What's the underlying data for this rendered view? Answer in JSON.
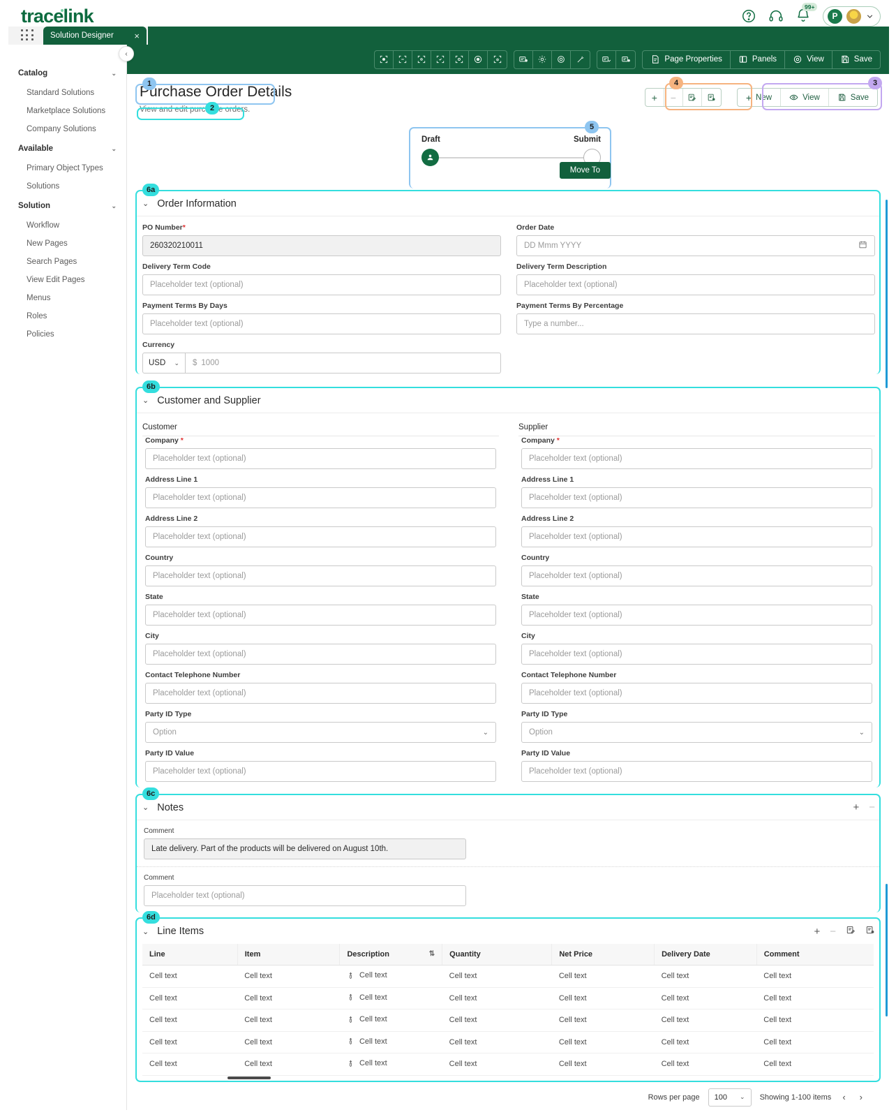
{
  "brand": {
    "name": "tracelink",
    "notification_badge": "99+",
    "account_initial": "P"
  },
  "tabs": {
    "active": "Solution Designer",
    "close": "×"
  },
  "sidebar": {
    "groups": [
      {
        "label": "Catalog",
        "items": [
          "Standard Solutions",
          "Marketplace Solutions",
          "Company Solutions"
        ]
      },
      {
        "label": "Available",
        "items": [
          "Primary Object Types",
          "Solutions"
        ]
      },
      {
        "label": "Solution",
        "items": [
          "Workflow",
          "New Pages",
          "Search Pages",
          "View Edit Pages",
          "Menus",
          "Roles",
          "Policies"
        ]
      }
    ]
  },
  "designer_toolbar": {
    "buttons": [
      {
        "label": "Page Properties",
        "icon": "page-properties-icon"
      },
      {
        "label": "Panels",
        "icon": "panels-icon"
      },
      {
        "label": "View",
        "icon": "eye-icon"
      },
      {
        "label": "Save",
        "icon": "save-icon"
      }
    ]
  },
  "page": {
    "title": "Purchase Order Details",
    "subtitle": "View and edit purchase orders."
  },
  "annotations": [
    {
      "id": "1",
      "color": "#8ec5f0",
      "target": "page-title"
    },
    {
      "id": "2",
      "color": "#34dede",
      "target": "page-subtitle"
    },
    {
      "id": "3",
      "color": "#c3a8f0",
      "target": "record-actions"
    },
    {
      "id": "4",
      "color": "#f6b37f",
      "target": "panel-actions"
    },
    {
      "id": "5",
      "color": "#8ec5f0",
      "target": "workflow"
    },
    {
      "id": "6a",
      "color": "#34dede",
      "target": "order-information"
    },
    {
      "id": "6b",
      "color": "#34dede",
      "target": "customer-and-supplier"
    },
    {
      "id": "6c",
      "color": "#34dede",
      "target": "notes"
    },
    {
      "id": "6d",
      "color": "#34dede",
      "target": "line-items"
    }
  ],
  "record_actions": {
    "new": "New",
    "view": "View",
    "save": "Save"
  },
  "panel_actions": {
    "add": "+",
    "remove": "−"
  },
  "workflow": {
    "steps": [
      "Draft",
      "Submit"
    ],
    "current_step": "Draft",
    "move_to": "Move To"
  },
  "order_information": {
    "title": "Order Information",
    "fields": [
      {
        "label": "PO Number",
        "required": true,
        "value": "260320210011",
        "placeholder": "",
        "type": "text-filled"
      },
      {
        "label": "Order Date",
        "required": false,
        "value": "",
        "placeholder": "DD Mmm YYYY",
        "type": "date"
      },
      {
        "label": "Delivery Term Code",
        "required": false,
        "value": "",
        "placeholder": "Placeholder text (optional)",
        "type": "text"
      },
      {
        "label": "Delivery Term Description",
        "required": false,
        "value": "",
        "placeholder": "Placeholder text (optional)",
        "type": "text"
      },
      {
        "label": "Payment Terms By Days",
        "required": false,
        "value": "",
        "placeholder": "Placeholder text (optional)",
        "type": "text"
      },
      {
        "label": "Payment Terms By Percentage",
        "required": false,
        "value": "",
        "placeholder": "Type a number...",
        "type": "number"
      }
    ],
    "currency": {
      "label": "Currency",
      "selected": "USD",
      "symbol": "$",
      "amount_placeholder": "1000"
    }
  },
  "customer_and_supplier": {
    "title": "Customer and Supplier",
    "customer_header": "Customer",
    "supplier_header": "Supplier",
    "fields": [
      {
        "label": "Company",
        "required": true,
        "placeholder": "Placeholder text (optional)",
        "type": "text"
      },
      {
        "label": "Address Line 1",
        "required": false,
        "placeholder": "Placeholder text (optional)",
        "type": "text"
      },
      {
        "label": "Address Line 2",
        "required": false,
        "placeholder": "Placeholder text (optional)",
        "type": "text"
      },
      {
        "label": "Country",
        "required": false,
        "placeholder": "Placeholder text (optional)",
        "type": "text"
      },
      {
        "label": "State",
        "required": false,
        "placeholder": "Placeholder text (optional)",
        "type": "text"
      },
      {
        "label": "City",
        "required": false,
        "placeholder": "Placeholder text (optional)",
        "type": "text"
      },
      {
        "label": "Contact Telephone Number",
        "required": false,
        "placeholder": "Placeholder text (optional)",
        "type": "text"
      },
      {
        "label": "Party ID Type",
        "required": false,
        "placeholder": "Option",
        "type": "select"
      },
      {
        "label": "Party ID Value",
        "required": false,
        "placeholder": "Placeholder text (optional)",
        "type": "text"
      }
    ]
  },
  "notes": {
    "title": "Notes",
    "add": "+",
    "collapse": "−",
    "rows": [
      {
        "label": "Comment",
        "value": "Late delivery. Part of the products will be delivered on August 10th.",
        "placeholder": ""
      },
      {
        "label": "Comment",
        "value": "",
        "placeholder": "Placeholder text (optional)"
      }
    ]
  },
  "line_items": {
    "title": "Line Items",
    "add": "+",
    "remove": "−",
    "columns": [
      "Line",
      "Item",
      "Description",
      "Quantity",
      "Net Price",
      "Delivery Date",
      "Comment"
    ],
    "sortable_column": "Description",
    "rows": [
      [
        "Cell text",
        "Cell text",
        "Cell text",
        "Cell text",
        "Cell text",
        "Cell text",
        "Cell text"
      ],
      [
        "Cell text",
        "Cell text",
        "Cell text",
        "Cell text",
        "Cell text",
        "Cell text",
        "Cell text"
      ],
      [
        "Cell text",
        "Cell text",
        "Cell text",
        "Cell text",
        "Cell text",
        "Cell text",
        "Cell text"
      ],
      [
        "Cell text",
        "Cell text",
        "Cell text",
        "Cell text",
        "Cell text",
        "Cell text",
        "Cell text"
      ],
      [
        "Cell text",
        "Cell text",
        "Cell text",
        "Cell text",
        "Cell text",
        "Cell text",
        "Cell text"
      ]
    ],
    "footer": {
      "rows_per_page_label": "Rows per page",
      "rows_per_page_value": "100",
      "showing": "Showing 1-100 items",
      "prev": "‹",
      "next": "›"
    }
  },
  "colors": {
    "brand_green": "#12603c",
    "accent_teal": "#34dede",
    "accent_blue": "#8ec5f0",
    "accent_orange": "#f6b37f",
    "accent_purple": "#c3a8f0"
  }
}
